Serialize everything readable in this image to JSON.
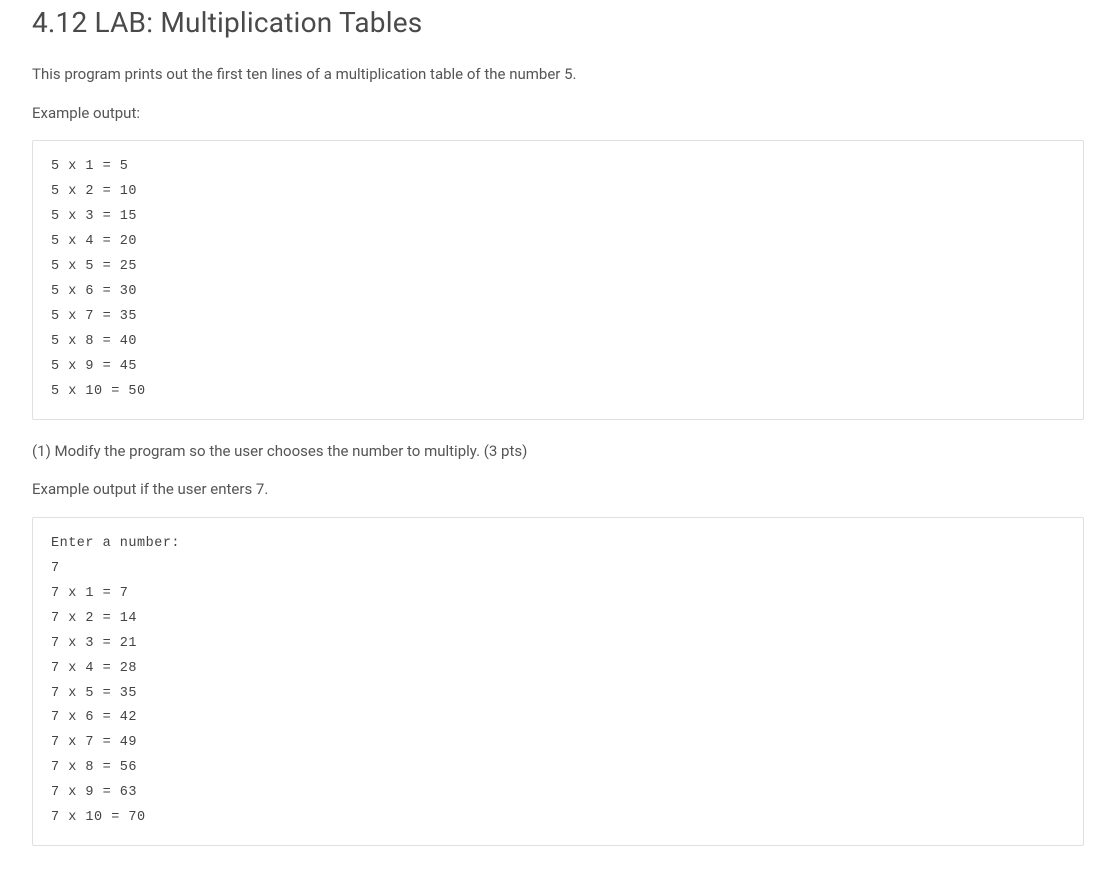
{
  "heading": "4.12 LAB: Multiplication Tables",
  "intro": "This program prints out the first ten lines of a multiplication table of the number 5.",
  "example_label_1": "Example output:",
  "code_block_1": "5 x 1 = 5\n5 x 2 = 10\n5 x 3 = 15\n5 x 4 = 20\n5 x 5 = 25\n5 x 6 = 30\n5 x 7 = 35\n5 x 8 = 40\n5 x 9 = 45\n5 x 10 = 50",
  "task_1": "(1) Modify the program so the user chooses the number to multiply. (3 pts)",
  "example_label_2": "Example output if the user enters 7.",
  "code_block_2": "Enter a number:\n7\n7 x 1 = 7\n7 x 2 = 14\n7 x 3 = 21\n7 x 4 = 28\n7 x 5 = 35\n7 x 6 = 42\n7 x 7 = 49\n7 x 8 = 56\n7 x 9 = 63\n7 x 10 = 70"
}
